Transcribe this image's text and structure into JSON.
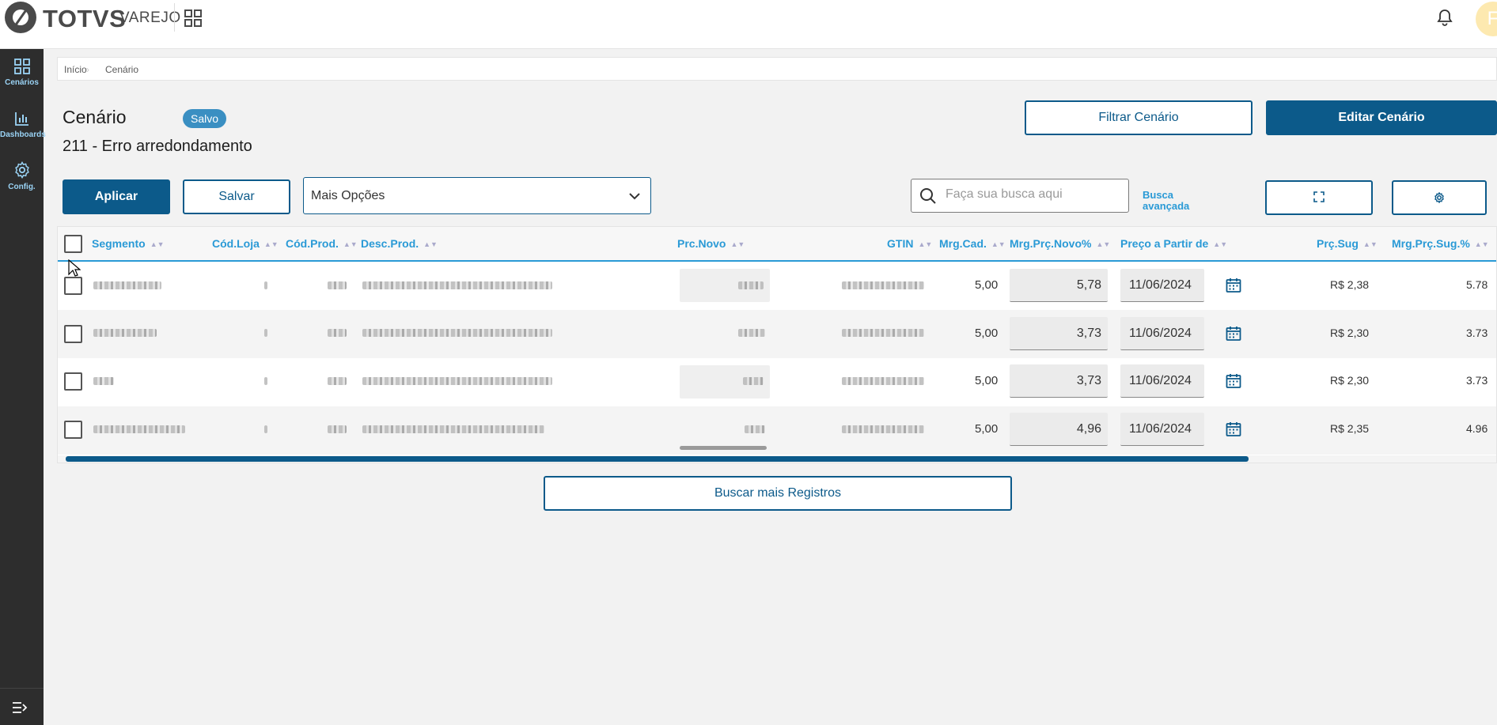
{
  "brand": {
    "name": "TOTVS",
    "product": "VAREJO"
  },
  "user": {
    "initial": "F"
  },
  "sidebar": {
    "items": [
      {
        "label": "Cenários",
        "icon": "grid-icon"
      },
      {
        "label": "Dashboards",
        "icon": "chart-icon"
      },
      {
        "label": "Config.",
        "icon": "gear-icon"
      }
    ],
    "collapse_icon": "collapse-menu-icon"
  },
  "breadcrumb": [
    "Início",
    "Cenário"
  ],
  "page": {
    "title": "Cenário",
    "status": "Salvo",
    "subtitle": "211 - Erro arredondamento"
  },
  "actions": {
    "filter": "Filtrar Cenário",
    "edit": "Editar Cenário",
    "apply": "Aplicar",
    "save": "Salvar",
    "more_options": "Mais Opções",
    "search_placeholder": "Faça sua busca aqui",
    "advanced_search": [
      "Busca",
      "avançada"
    ],
    "load_more": "Buscar mais Registros"
  },
  "table": {
    "columns": [
      "Segmento",
      "Cód.Loja",
      "Cód.Prod.",
      "Desc.Prod.",
      "Prc.Novo",
      "GTIN",
      "Mrg.Cad.",
      "Mrg.Prç.Novo%",
      "Preço a Partir de",
      "Prç.Sug",
      "Mrg.Prç.Sug.%"
    ],
    "rows": [
      {
        "mrg_cad": "5,00",
        "mrg_novo": "5,78",
        "date": "11/06/2024",
        "prc_sug": "R$ 2,38",
        "mrg_sug": "5.78"
      },
      {
        "mrg_cad": "5,00",
        "mrg_novo": "3,73",
        "date": "11/06/2024",
        "prc_sug": "R$ 2,30",
        "mrg_sug": "3.73"
      },
      {
        "mrg_cad": "5,00",
        "mrg_novo": "3,73",
        "date": "11/06/2024",
        "prc_sug": "R$ 2,30",
        "mrg_sug": "3.73"
      },
      {
        "mrg_cad": "5,00",
        "mrg_novo": "4,96",
        "date": "11/06/2024",
        "prc_sug": "R$ 2,35",
        "mrg_sug": "4.96"
      }
    ]
  },
  "colors": {
    "primary": "#0c5a8a",
    "accent": "#2a9ad6",
    "sidebar": "#2d2d2d",
    "badge": "#3a8fc2"
  }
}
